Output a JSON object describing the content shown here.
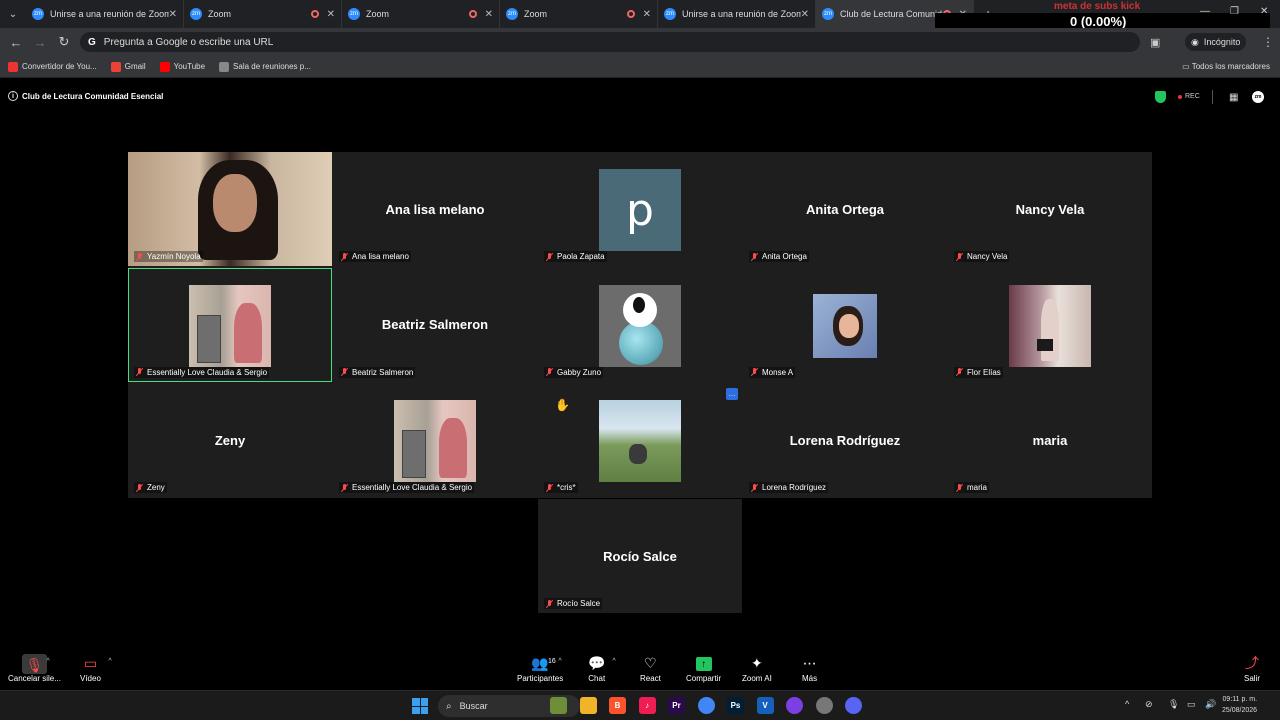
{
  "browser": {
    "tabs": [
      {
        "title": "Unirse a una reunión de Zoom",
        "recording": false
      },
      {
        "title": "Zoom",
        "recording": true
      },
      {
        "title": "Zoom",
        "recording": true
      },
      {
        "title": "Zoom",
        "recording": true
      },
      {
        "title": "Unirse a una reunión de Zoom",
        "recording": false
      },
      {
        "title": "Club de Lectura Comunidad Esencial",
        "recording": true,
        "active": true
      }
    ],
    "overlay": {
      "heading": "meta de subs kick",
      "value": "0 (0.00%)",
      "sub_value": "0"
    },
    "address_placeholder": "Pregunta a Google o escribe una URL",
    "incognito_label": "Incógnito",
    "bookmarks": [
      {
        "label": "Convertidor de You...",
        "color": "#e33"
      },
      {
        "label": "Gmail",
        "color": "#ea4335"
      },
      {
        "label": "YouTube",
        "color": "#ff0000"
      },
      {
        "label": "Sala de reuniones p...",
        "color": "#888"
      }
    ],
    "all_bookmarks_label": "Todos los marcadores"
  },
  "meeting": {
    "title": "Club de Lectura Comunidad Esencial",
    "rec_label": "REC",
    "zoom_icon_text": "zm",
    "participants": [
      {
        "name": "Yazmín Noyola",
        "display": "",
        "kind": "video"
      },
      {
        "name": "Ana lisa melano",
        "display": "Ana lisa melano",
        "kind": "name"
      },
      {
        "name": "Paola Zapata",
        "display": "",
        "kind": "letter",
        "letter": "p"
      },
      {
        "name": "Anita Ortega",
        "display": "Anita Ortega",
        "kind": "name"
      },
      {
        "name": "Nancy Vela",
        "display": "Nancy Vela",
        "kind": "name"
      },
      {
        "name": "Essentially Love Claudia & Sergio",
        "display": "",
        "kind": "photo-ess"
      },
      {
        "name": "Beatriz Salmeron",
        "display": "Beatriz Salmeron",
        "kind": "name"
      },
      {
        "name": "Gabby Zuno",
        "display": "",
        "kind": "photo-snoopy"
      },
      {
        "name": "Monse A",
        "display": "",
        "kind": "photo-monse"
      },
      {
        "name": "Flor Elías",
        "display": "",
        "kind": "photo-flor"
      },
      {
        "name": "Zeny",
        "display": "Zeny",
        "kind": "name"
      },
      {
        "name": "Essentially Love Claudia & Sergio",
        "display": "",
        "kind": "photo-ess"
      },
      {
        "name": "*cris*",
        "display": "",
        "kind": "photo-cris"
      },
      {
        "name": "Lorena Rodríguez",
        "display": "Lorena Rodríguez",
        "kind": "name"
      },
      {
        "name": "maria",
        "display": "maria",
        "kind": "name"
      },
      {
        "name": "Rocío Salce",
        "display": "Rocío Salce",
        "kind": "name"
      }
    ]
  },
  "toolbar": {
    "mute_label": "Cancelar sile...",
    "video_label": "Vídeo",
    "participants_label": "Participantes",
    "participants_count": "16",
    "chat_label": "Chat",
    "react_label": "React",
    "share_label": "Compartir",
    "ai_label": "Zoom AI",
    "more_label": "Más",
    "leave_label": "Salir"
  },
  "taskbar": {
    "search_label": "Buscar",
    "time": "09:11 p. m.",
    "date": "25/08/2026",
    "apps": [
      {
        "name": "game",
        "letter": "",
        "color": "#6d8f3a"
      },
      {
        "name": "explorer",
        "letter": "",
        "color": "#f0b429"
      },
      {
        "name": "brave",
        "letter": "B",
        "color": "#fb542b"
      },
      {
        "name": "tiktok",
        "letter": "♪",
        "color": "#ee1d52"
      },
      {
        "name": "premiere",
        "letter": "Pr",
        "color": "#2a0a4a"
      },
      {
        "name": "chrome",
        "letter": "",
        "color": "#4285f4"
      },
      {
        "name": "photoshop",
        "letter": "Ps",
        "color": "#001e36"
      },
      {
        "name": "vegas",
        "letter": "V",
        "color": "#1560bd"
      },
      {
        "name": "obs",
        "letter": "",
        "color": "#7b3fe4"
      },
      {
        "name": "chrome-incognito",
        "letter": "",
        "color": "#777"
      },
      {
        "name": "discord",
        "letter": "",
        "color": "#5865f2"
      }
    ]
  }
}
